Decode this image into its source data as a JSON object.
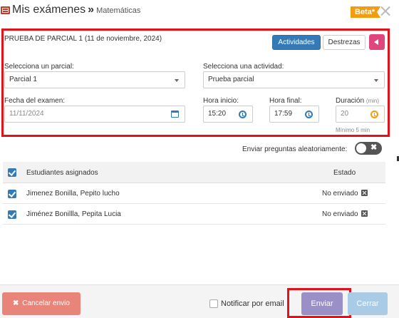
{
  "header": {
    "title": "Mis exámenes",
    "separator": "»",
    "subtitle": "Matemáticas",
    "badge": "Beta*"
  },
  "panel": {
    "title": "PRUEBA DE PARCIAL 1 (11 de noviembre, 2024)",
    "tabs": {
      "activities": "Actividades",
      "skills": "Destrezas"
    },
    "partial": {
      "label": "Selecciona un parcial:",
      "value": "Parcial 1"
    },
    "activity": {
      "label": "Selecciona una actividad:",
      "value": "Prueba parcial"
    },
    "date": {
      "label": "Fecha del examen:",
      "value": "11/11/2024"
    },
    "start": {
      "label": "Hora inicio:",
      "value": "15:20"
    },
    "end": {
      "label": "Hora final:",
      "value": "17:59"
    },
    "duration": {
      "label": "Duración",
      "unit": "(min)",
      "value": "20",
      "hint": "Mínimo 5 min"
    }
  },
  "random_questions": {
    "label": "Enviar preguntas aleatoriamente:",
    "toggle_symbol": "✖",
    "enabled": false
  },
  "table": {
    "headers": {
      "students": "Estudiantes asignados",
      "status": "Estado"
    },
    "rows": [
      {
        "name": "Jimenez Bonilla, Pepito lucho",
        "status": "No enviado"
      },
      {
        "name": "Jiménez Bonillla, Pepita Lucia",
        "status": "No enviado"
      }
    ]
  },
  "footer": {
    "cancel": "Cancelar envio",
    "cancel_icon": "✖",
    "notify": "Notificar por email",
    "send": "Enviar",
    "close": "Cerrar"
  },
  "colors": {
    "primary": "#337ab7",
    "highlight": "#e3111a",
    "badge": "#f39c12",
    "back_button": "#e0467c",
    "cancel": "#e8847a",
    "send": "#9b8fc8",
    "close": "#a9cbe6"
  },
  "icons": {
    "header": "exam-list-icon",
    "close": "close-icon",
    "back": "back-arrow-icon",
    "calendar": "calendar-icon",
    "clock": "clock-icon",
    "status": "x-square-icon"
  }
}
